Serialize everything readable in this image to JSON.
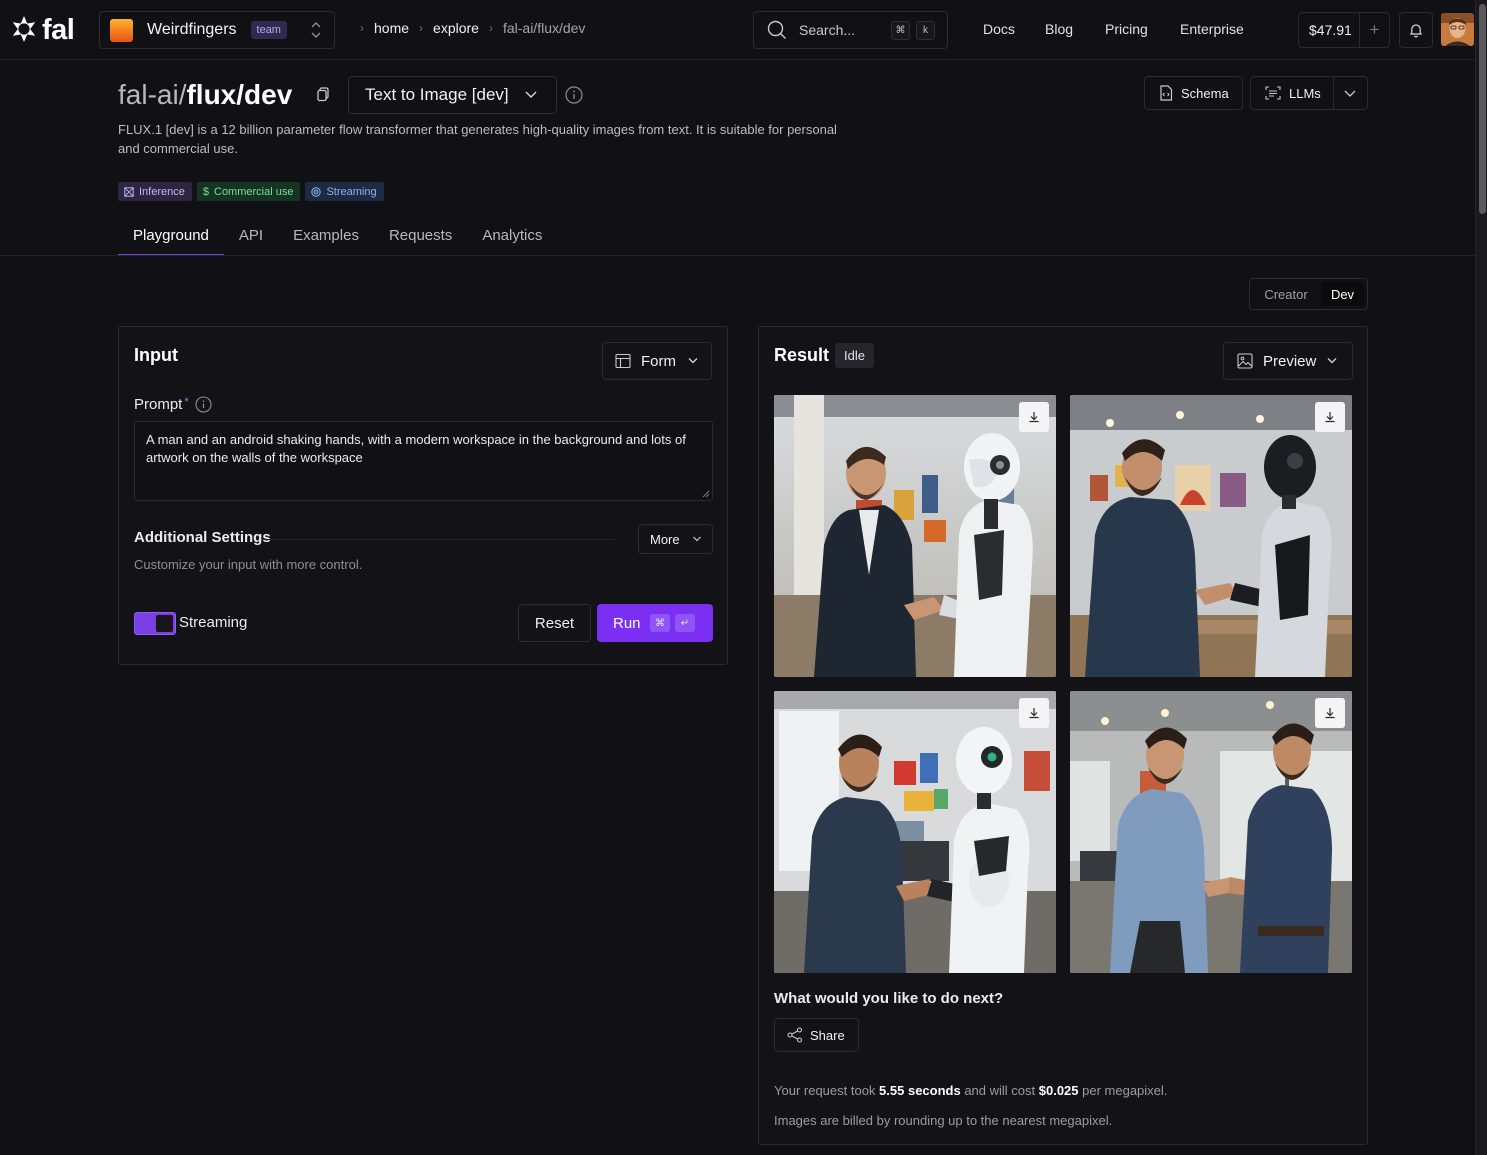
{
  "nav": {
    "brand": "fal",
    "team": {
      "name": "Weirdfingers",
      "badge": "team"
    },
    "breadcrumb": [
      "home",
      "explore",
      "fal-ai/flux/dev"
    ],
    "search": {
      "placeholder": "Search...",
      "shortcut": [
        "⌘",
        "k"
      ]
    },
    "links": [
      "Docs",
      "Blog",
      "Pricing",
      "Enterprise"
    ],
    "credits": "$47.91",
    "add_credits": "+"
  },
  "model": {
    "owner": "fal-ai/",
    "name": "flux/dev",
    "category": "Text to Image [dev]",
    "description": "FLUX.1 [dev] is a 12 billion parameter flow transformer that generates high-quality images from text. It is suitable for personal and commercial use.",
    "tags": [
      "Inference",
      "Commercial use",
      "Streaming"
    ],
    "schema_label": "Schema",
    "llms_label": "LLMs"
  },
  "tabs": [
    "Playground",
    "API",
    "Examples",
    "Requests",
    "Analytics"
  ],
  "active_tab": "Playground",
  "mode": {
    "options": [
      "Creator",
      "Dev"
    ],
    "selected": "Dev"
  },
  "input": {
    "title": "Input",
    "view_select": "Form",
    "prompt_label": "Prompt",
    "required_mark": "*",
    "prompt_value": "A man and an android shaking hands, with a modern workspace in the background and lots of artwork on the walls of the workspace",
    "additional_settings": "Additional Settings",
    "more_label": "More",
    "settings_hint": "Customize your input with more control.",
    "streaming_label": "Streaming",
    "streaming_on": true,
    "reset_label": "Reset",
    "run_label": "Run",
    "run_shortcut": [
      "⌘",
      "↵"
    ]
  },
  "result": {
    "title": "Result",
    "status": "Idle",
    "view_select": "Preview",
    "images": [
      {
        "name": "man-shaking-hands-with-white-android"
      },
      {
        "name": "man-shaking-hands-with-black-android"
      },
      {
        "name": "man-shaking-hands-with-white-robot"
      },
      {
        "name": "two-men-shaking-hands"
      }
    ],
    "next_title": "What would you like to do next?",
    "share_label": "Share",
    "cost_prefix": "Your request took ",
    "duration": "5.55 seconds",
    "cost_middle": " and will cost ",
    "cost": "$0.025",
    "cost_suffix": " per megapixel.",
    "billing_note": "Images are billed by rounding up to the nearest megapixel."
  },
  "colors": {
    "accent": "#7b2ff2",
    "background": "#111014",
    "inference_tag": "#c7b5f3",
    "commercial_tag": "#72e09a",
    "streaming_tag": "#8ab5f2"
  }
}
